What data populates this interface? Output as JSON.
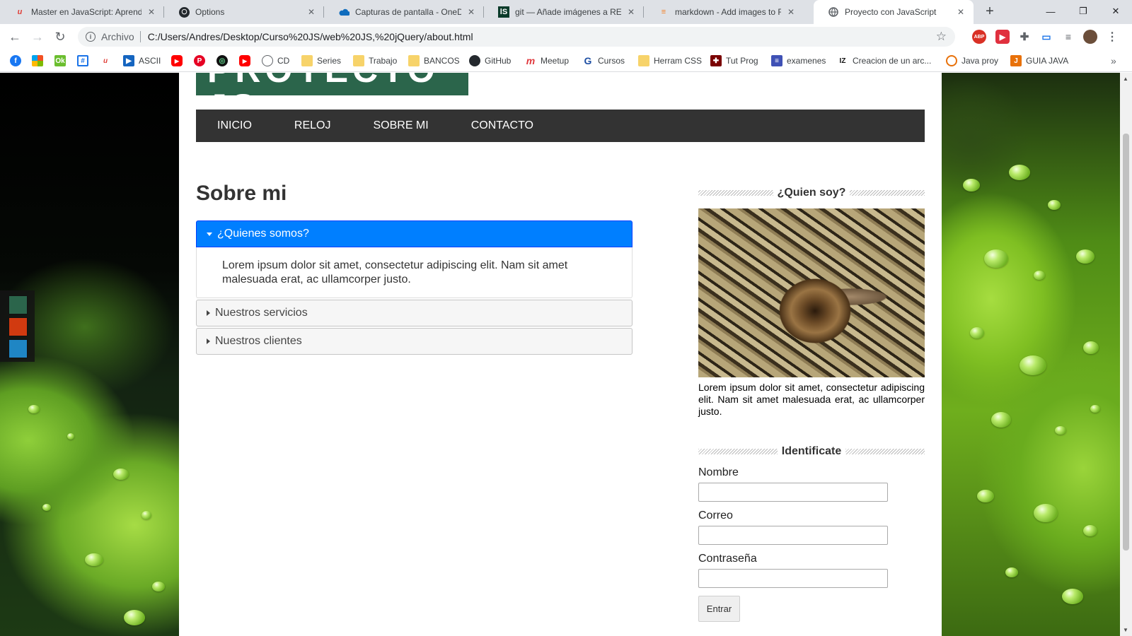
{
  "browser": {
    "tabs": [
      {
        "title": "Master en JavaScript: Aprender",
        "favicon": "udemy-icon",
        "active": false
      },
      {
        "title": "Options",
        "favicon": "github-icon",
        "active": false
      },
      {
        "title": "Capturas de pantalla - OneDrive",
        "favicon": "onedrive-icon",
        "active": false
      },
      {
        "title": "git — Añade imágenes a README",
        "favicon": "git-icon",
        "active": false
      },
      {
        "title": "markdown - Add images to RE",
        "favicon": "stackoverflow-icon",
        "active": false
      },
      {
        "title": "Proyecto con JavaScript",
        "favicon": "globe-icon",
        "active": true
      }
    ],
    "address": {
      "scheme_label": "Archivo",
      "url": "C:/Users/Andres/Desktop/Curso%20JS/web%20JS,%20jQuery/about.html"
    },
    "bookmarks": [
      {
        "label": "",
        "icon": "facebook-icon"
      },
      {
        "label": "",
        "icon": "microsoft-icon"
      },
      {
        "label": "",
        "icon": "office-icon"
      },
      {
        "label": "",
        "icon": "grid-icon"
      },
      {
        "label": "",
        "icon": "udemy-icon"
      },
      {
        "label": "ASCII",
        "icon": "ascii-icon"
      },
      {
        "label": "",
        "icon": "youtube-icon"
      },
      {
        "label": "",
        "icon": "pinterest-icon"
      },
      {
        "label": "",
        "icon": "circle-icon"
      },
      {
        "label": "",
        "icon": "youtube-icon"
      },
      {
        "label": "CD",
        "icon": "globe-icon"
      },
      {
        "label": "Series",
        "icon": "folder-icon"
      },
      {
        "label": "Trabajo",
        "icon": "folder-icon"
      },
      {
        "label": "BANCOS",
        "icon": "folder-icon"
      },
      {
        "label": "GitHub",
        "icon": "github-icon"
      },
      {
        "label": "Meetup",
        "icon": "meetup-icon"
      },
      {
        "label": "Cursos",
        "icon": "cursos-icon"
      },
      {
        "label": "Herram CSS",
        "icon": "folder-icon"
      },
      {
        "label": "Tut Prog",
        "icon": "tutprog-icon"
      },
      {
        "label": "examenes",
        "icon": "forms-icon"
      },
      {
        "label": "Creacion de un arc...",
        "icon": "iz-icon"
      },
      {
        "label": "Java proy",
        "icon": "java-icon"
      },
      {
        "label": "GUIA JAVA",
        "icon": "guia-icon"
      }
    ]
  },
  "site": {
    "logo_text": "PROYECTO JS",
    "menu": [
      "INICIO",
      "RELOJ",
      "SOBRE MI",
      "CONTACTO"
    ],
    "title": "Sobre mi",
    "accordion": [
      {
        "header": "¿Quienes somos?",
        "open": true,
        "body": "Lorem ipsum dolor sit amet, consectetur adipiscing elit. Nam sit amet malesuada erat, ac ullamcorper justo."
      },
      {
        "header": "Nuestros servicios",
        "open": false
      },
      {
        "header": "Nuestros clientes",
        "open": false
      }
    ],
    "sidebar": {
      "about_title": "¿Quien soy?",
      "about_text": "Lorem ipsum dolor sit amet, consectetur adipiscing elit. Nam sit amet malesuada erat, ac ullamcorper justo.",
      "login_title": "Identificate",
      "fields": [
        {
          "label": "Nombre",
          "value": ""
        },
        {
          "label": "Correo",
          "value": ""
        },
        {
          "label": "Contraseña",
          "value": ""
        }
      ],
      "submit_label": "Entrar"
    },
    "theme_colors": [
      "#2b654b",
      "#d13a10",
      "#1f86c4"
    ]
  }
}
